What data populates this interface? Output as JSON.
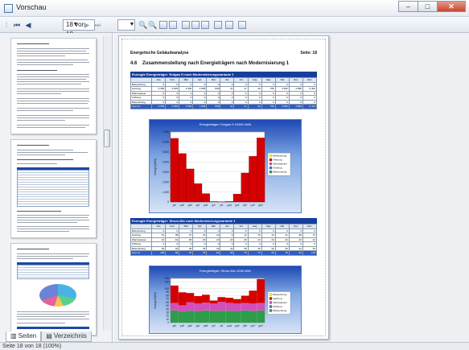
{
  "window": {
    "title": "Vorschau",
    "minimize": "–",
    "maximize": "□",
    "close": "✕"
  },
  "toolbar": {
    "page_display": "18 von 18"
  },
  "left_panel": {
    "tabs": [
      {
        "label": "Seiten"
      },
      {
        "label": "Verzeichnis"
      }
    ]
  },
  "page": {
    "header_left": "Energetische Gebäudeanalyse",
    "header_right": "Seite:   18",
    "section_number": "4.6",
    "section_title": "Zusammenstellung nach Energieträgern nach Modernisierung 1",
    "months": [
      "Jan",
      "Feb",
      "Mär",
      "Apr",
      "Mai",
      "Jun",
      "Jul",
      "Aug",
      "Sep",
      "Okt",
      "Nov",
      "Dez"
    ],
    "table1": {
      "heading": "Erzeugte Energieträger: Erdgas H nach Modernisierungsvariante 1",
      "rows": [
        {
          "label": "Beleuchtung",
          "values": [
            "0",
            "0",
            "0",
            "0",
            "0",
            "0",
            "0",
            "0",
            "0",
            "0",
            "0",
            "0"
          ]
        },
        {
          "label": "Heizung",
          "values": [
            "6.359",
            "4.839",
            "3.303",
            "1.838",
            "838",
            "41",
            "17",
            "49",
            "795",
            "2.900",
            "4.568",
            "6.404"
          ]
        },
        {
          "label": "Warmwasser",
          "values": [
            "0",
            "0",
            "0",
            "0",
            "0",
            "0",
            "0",
            "0",
            "0",
            "0",
            "0",
            "0"
          ]
        },
        {
          "label": "Kühlung",
          "values": [
            "0",
            "0",
            "0",
            "0",
            "0",
            "0",
            "0",
            "0",
            "0",
            "0",
            "0",
            "0"
          ]
        },
        {
          "label": "Befeuchtung",
          "values": [
            "0",
            "0",
            "0",
            "0",
            "0",
            "0",
            "0",
            "0",
            "0",
            "0",
            "0",
            "0"
          ]
        },
        {
          "label": "Summe",
          "values": [
            "6.359",
            "4.839",
            "3.303",
            "1.838",
            "838",
            "41",
            "17",
            "49",
            "795",
            "2.900",
            "4.568",
            "6.404"
          ]
        }
      ]
    },
    "table2": {
      "heading": "Erzeugte Energieträger: Strom-Mix nach Modernisierungsvariante 1",
      "rows": [
        {
          "label": "Beleuchtung",
          "values": [
            "0",
            "0",
            "0",
            "0",
            "0",
            "0",
            "0",
            "0",
            "0",
            "0",
            "0",
            "0"
          ]
        },
        {
          "label": "Heizung",
          "values": [
            "51",
            "38",
            "27",
            "22",
            "23",
            "9",
            "14",
            "15",
            "13",
            "21",
            "38",
            "70"
          ]
        },
        {
          "label": "Warmwasser",
          "values": [
            "22",
            "19",
            "25",
            "23",
            "23",
            "22",
            "26",
            "23",
            "23",
            "22",
            "22",
            "22"
          ]
        },
        {
          "label": "Kühlung",
          "values": [
            "0",
            "0",
            "0",
            "0",
            "0",
            "0",
            "0",
            "0",
            "0",
            "0",
            "0",
            "0"
          ]
        },
        {
          "label": "Befeuchtung",
          "values": [
            "36",
            "32",
            "35",
            "33",
            "36",
            "34",
            "35",
            "35",
            "33",
            "36",
            "34",
            "36"
          ]
        },
        {
          "label": "Summe",
          "values": [
            "109",
            "89",
            "87",
            "78",
            "82",
            "65",
            "75",
            "73",
            "69",
            "79",
            "94",
            "128"
          ]
        }
      ]
    }
  },
  "chart_data": [
    {
      "type": "bar",
      "title": "Energieträger: Erdgas H      31691 kWh",
      "ylabel": "Energie [kWh]",
      "categories": [
        "Jan",
        "Feb",
        "Mär",
        "Apr",
        "Mai",
        "Jun",
        "Jul",
        "Aug",
        "Sep",
        "Okt",
        "Nov",
        "Dez"
      ],
      "series": [
        {
          "name": "Heizung",
          "values": [
            6359,
            4839,
            3303,
            1838,
            838,
            41,
            17,
            49,
            795,
            2900,
            4568,
            6404
          ]
        }
      ],
      "ylim": [
        0,
        7000
      ],
      "yticks": [
        "7.000",
        "6.000",
        "5.000",
        "4.000",
        "3.000",
        "2.000",
        "1.000",
        "0"
      ],
      "legend": [
        "Beleuchtung",
        "Heizung",
        "Warmwasser",
        "Kühlung",
        "Befeuchtung"
      ],
      "colors": {
        "Beleuchtung": "#ffff00",
        "Heizung": "#d50000",
        "Warmwasser": "#d24fb9",
        "Kühlung": "#3a6fe0",
        "Befeuchtung": "#2e9c4a"
      },
      "legend_position": "right",
      "grid": true
    },
    {
      "type": "area",
      "title": "Energieträger: Strom-Mix      1038 kWh",
      "ylabel": "Energie [kWh]",
      "categories": [
        "Jan",
        "Feb",
        "Mär",
        "Apr",
        "Mai",
        "Jun",
        "Jul",
        "Aug",
        "Sep",
        "Okt",
        "Nov",
        "Dez"
      ],
      "series": [
        {
          "name": "Befeuchtung",
          "values": [
            36,
            32,
            35,
            33,
            36,
            34,
            35,
            35,
            33,
            36,
            34,
            36
          ]
        },
        {
          "name": "Warmwasser",
          "values": [
            22,
            19,
            25,
            23,
            23,
            22,
            26,
            23,
            23,
            22,
            22,
            22
          ]
        },
        {
          "name": "Heizung",
          "values": [
            51,
            38,
            27,
            22,
            23,
            9,
            14,
            15,
            13,
            21,
            38,
            70
          ]
        }
      ],
      "ylim": [
        0,
        130
      ],
      "yticks": [
        "130",
        "120",
        "100",
        "90",
        "80",
        "70",
        "60",
        "50",
        "40",
        "30",
        "20",
        "10",
        "0"
      ],
      "legend": [
        "Beleuchtung",
        "Heizung",
        "Warmwasser",
        "Kühlung",
        "Befeuchtung"
      ],
      "colors": {
        "Beleuchtung": "#ffff00",
        "Heizung": "#d50000",
        "Warmwasser": "#d24fb9",
        "Kühlung": "#3a6fe0",
        "Befeuchtung": "#2e9c4a"
      },
      "legend_position": "right",
      "grid": true
    }
  ],
  "status": {
    "text": "Seite 18 von 18 (100%)"
  }
}
